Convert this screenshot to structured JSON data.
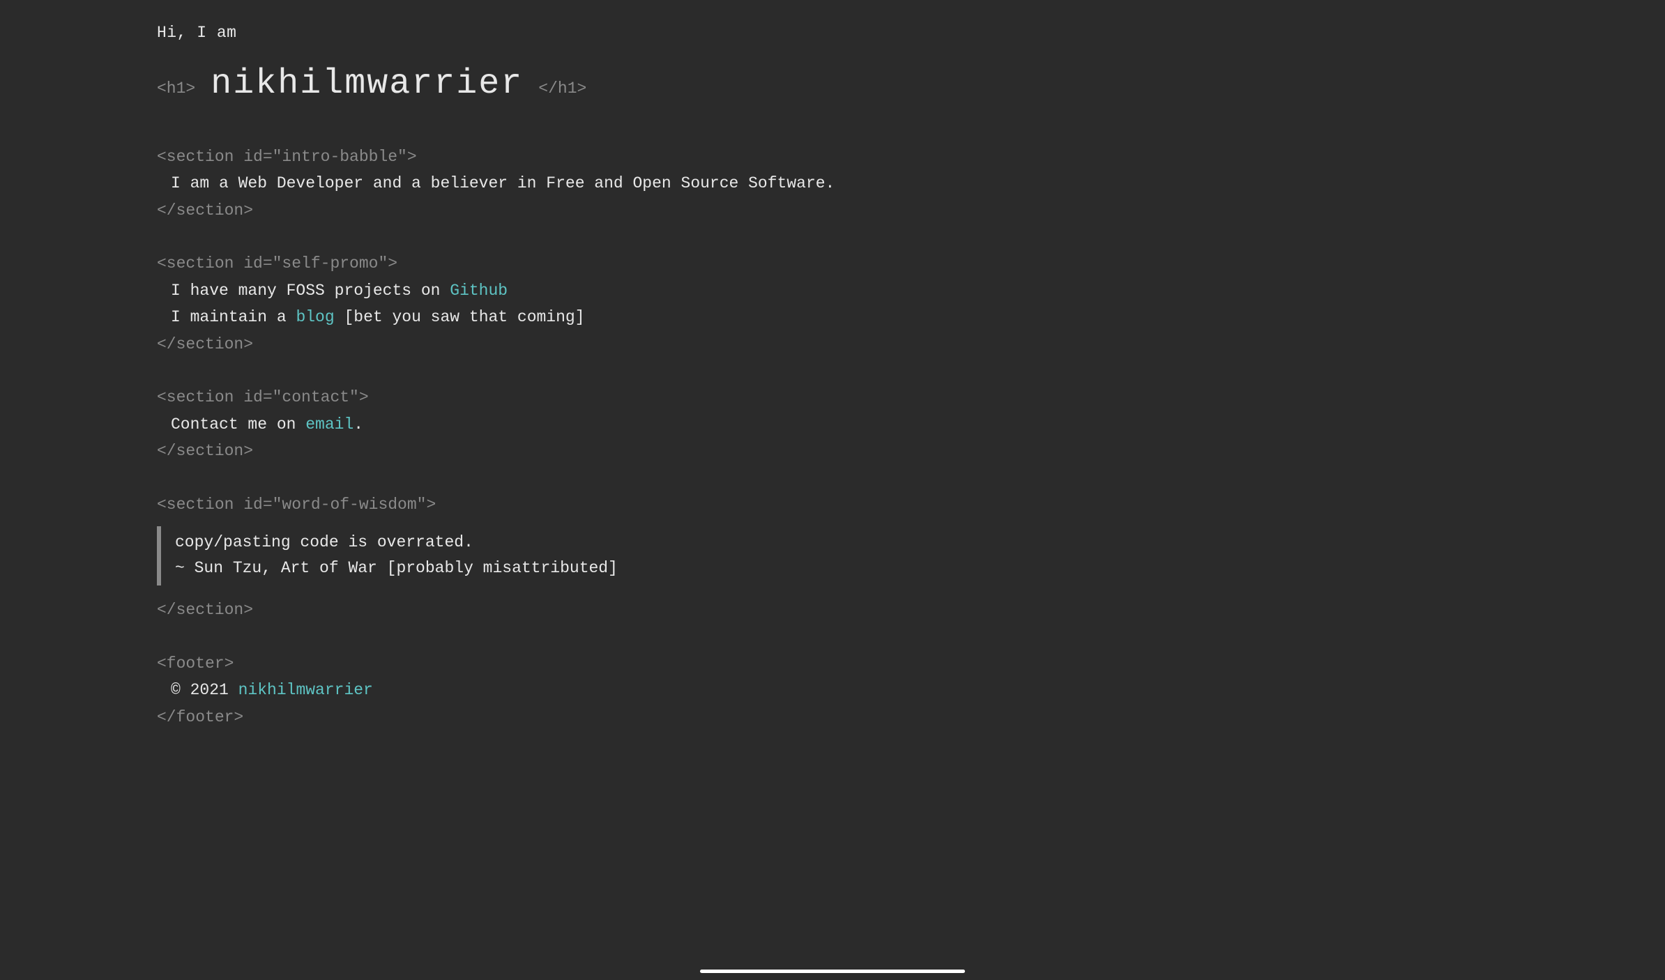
{
  "intro": "Hi, I am",
  "heading": {
    "open_tag": "<h1>",
    "text": "nikhilmwarrier",
    "close_tag": "</h1>"
  },
  "sections": {
    "intro_babble": {
      "open": "<section id=\"intro-babble\">",
      "line1": "I am a Web Developer and a believer in Free and Open Source Software.",
      "close": "</section>"
    },
    "self_promo": {
      "open": "<section id=\"self-promo\">",
      "line1_pre": "I have many FOSS projects on ",
      "line1_link": "Github",
      "line2_pre": "I maintain a ",
      "line2_link": "blog",
      "line2_post": " [bet you saw that coming]",
      "close": "</section>"
    },
    "contact": {
      "open": "<section id=\"contact\">",
      "line1_pre": "Contact me on ",
      "line1_link": "email",
      "line1_post": ".",
      "close": "</section>"
    },
    "wisdom": {
      "open": "<section id=\"word-of-wisdom\">",
      "quote_line1": "copy/pasting code is overrated.",
      "quote_line2": " ~ Sun Tzu, Art of War [probably misattributed]",
      "close": "</section>"
    }
  },
  "footer": {
    "open": "<footer>",
    "copyright_pre": "© 2021 ",
    "copyright_link": "nikhilmwarrier",
    "close": "</footer>"
  }
}
